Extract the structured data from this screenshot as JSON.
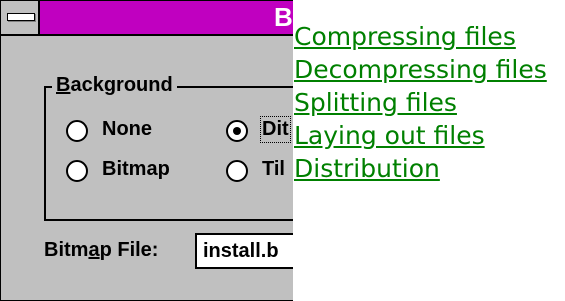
{
  "dialog": {
    "title_partial": "B",
    "group_label_accel": "B",
    "group_label_rest": "ackground",
    "options": {
      "none": "None",
      "dither_partial": "Dit",
      "bitmap": "Bitmap",
      "tile_partial": "Til"
    },
    "selected_option": "dither",
    "bitmap_file_label_a": "Bitm",
    "bitmap_file_label_accel": "a",
    "bitmap_file_label_b": "p File:",
    "bitmap_file_value": "install.b"
  },
  "links": [
    {
      "label": "Compressing files"
    },
    {
      "label": "Decompressing files"
    },
    {
      "label": "Splitting files"
    },
    {
      "label": "Laying out files"
    },
    {
      "label": "Distribution"
    }
  ],
  "colors": {
    "titlebar": "#c000c0",
    "dialog_bg": "#c0c0c0",
    "link": "#008000"
  }
}
